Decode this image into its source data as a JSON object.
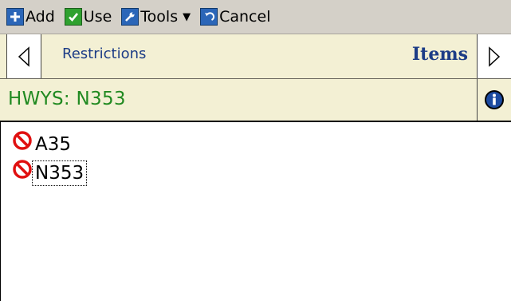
{
  "toolbar": {
    "add_label": "Add",
    "use_label": "Use",
    "tools_label": "Tools",
    "cancel_label": "Cancel"
  },
  "nav": {
    "section_label": "Restrictions",
    "mode_label": "Items"
  },
  "header": {
    "title": "HWYS: N353"
  },
  "list": {
    "items": [
      {
        "label": "A35",
        "icon": "prohibited-icon"
      },
      {
        "label": "N353",
        "icon": "prohibited-icon"
      }
    ]
  },
  "colors": {
    "toolbar_bg": "#d4d0c8",
    "nav_bg": "#f3f0d4",
    "title_green": "#218a21",
    "link_blue": "#1c3c86",
    "prohibited_red": "#e01010"
  }
}
